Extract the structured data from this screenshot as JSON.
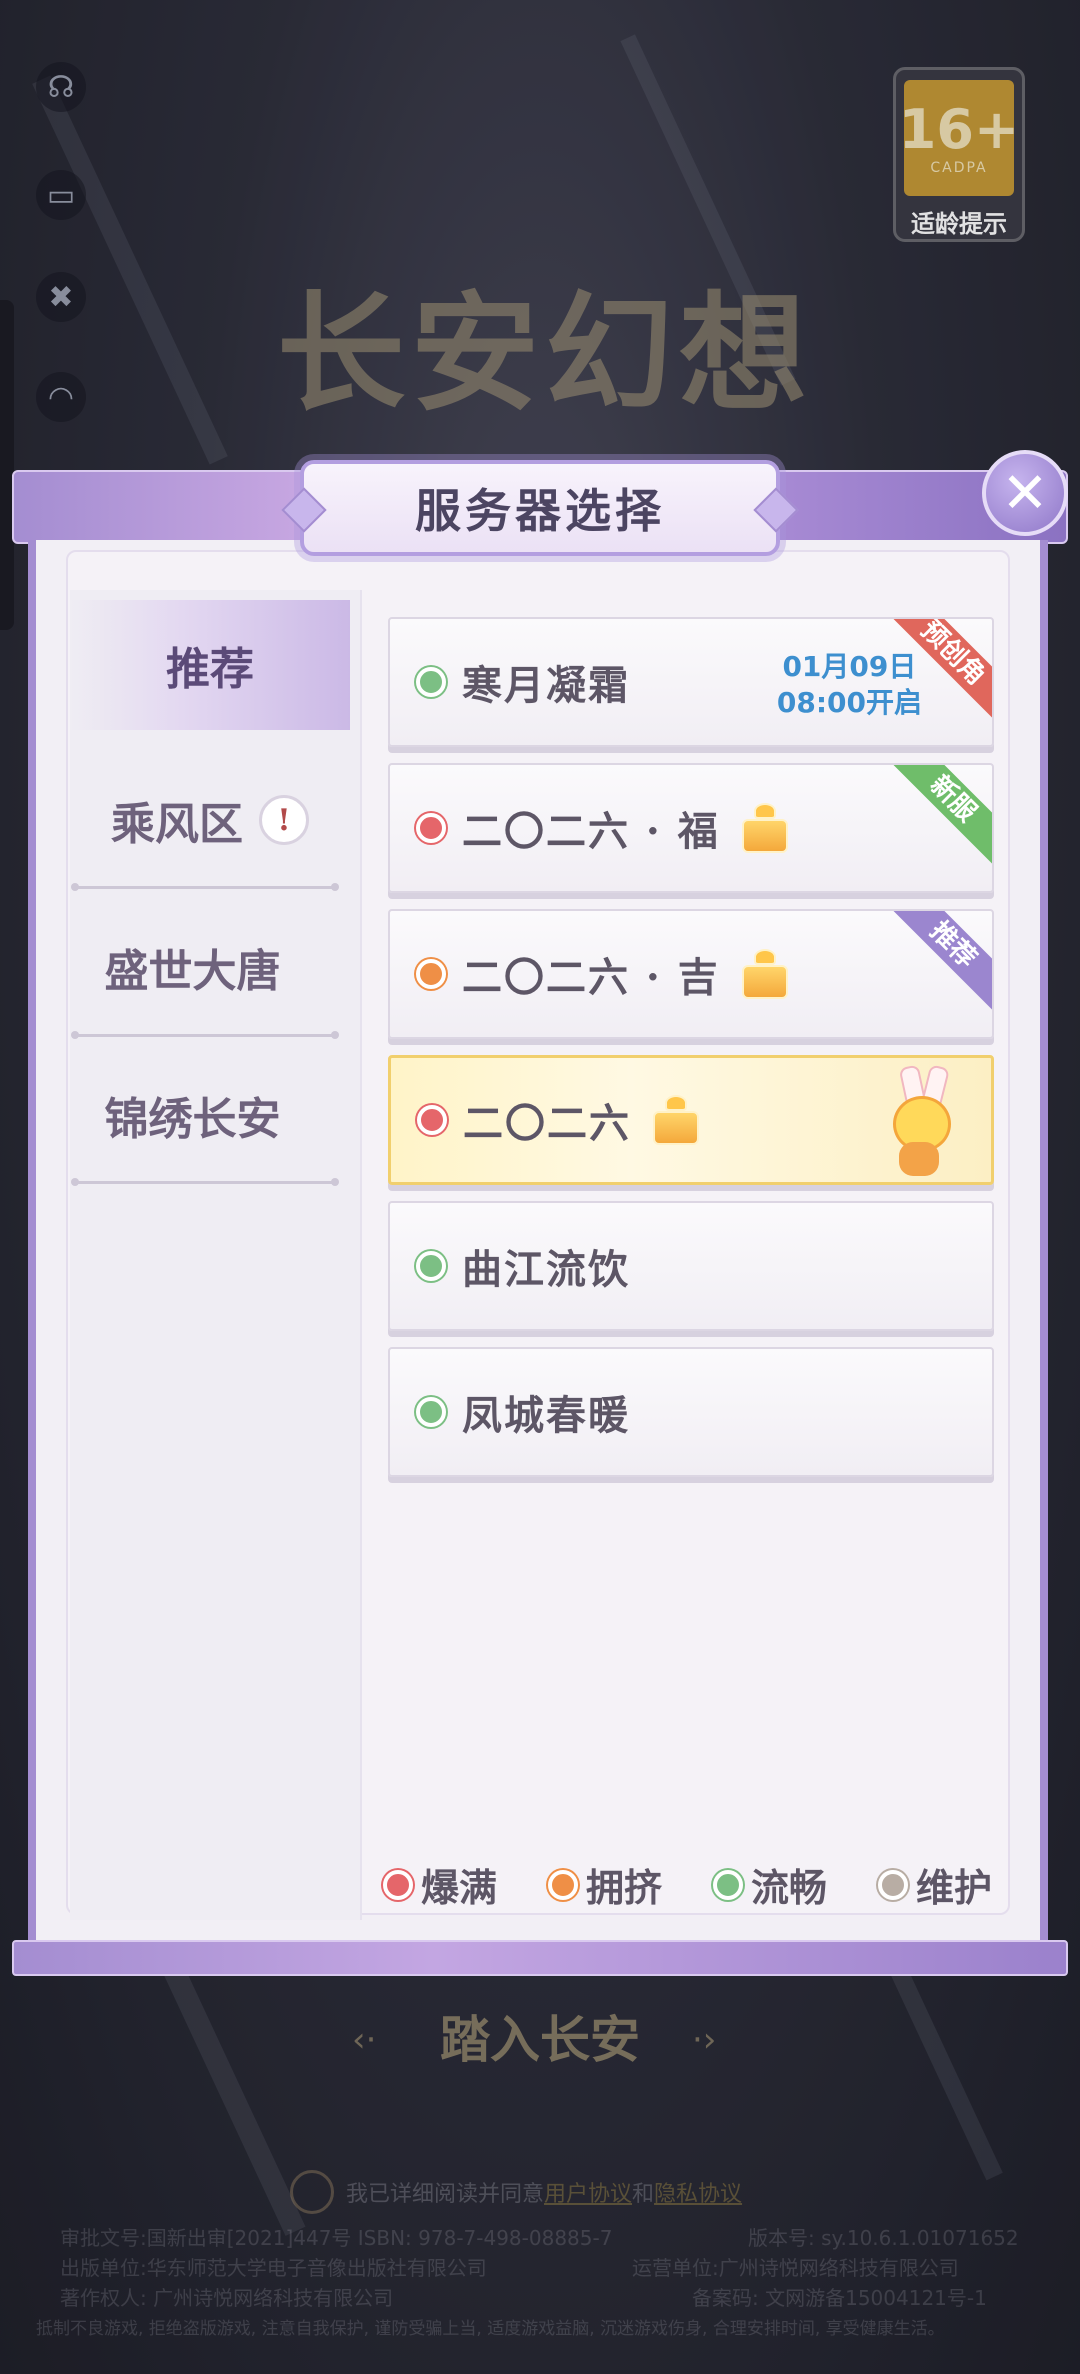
{
  "game": {
    "logo_text": "长安幻想"
  },
  "age_badge": {
    "number": "16+",
    "org": "CADPA",
    "label": "适龄提示"
  },
  "dialog": {
    "title": "服务器选择",
    "close_icon": "close-icon",
    "tabs": [
      {
        "label": "推荐",
        "active": true
      },
      {
        "label": "乘风区",
        "has_alert": true,
        "alert_symbol": "!"
      },
      {
        "label": "盛世大唐"
      },
      {
        "label": "锦绣长安"
      }
    ],
    "servers": [
      {
        "name": "寒月凝霜",
        "status": "流畅",
        "status_color": "#7cbf84",
        "open_date": "01月09日",
        "open_time": "08:00开启",
        "tag": "预创角",
        "tag_color": "#e0675c"
      },
      {
        "name": "二〇二六 · 福",
        "status": "爆满",
        "status_color": "#e5666a",
        "gift": true,
        "tag": "新服",
        "tag_color": "#6fbd6a"
      },
      {
        "name": "二〇二六 · 吉",
        "status": "拥挤",
        "status_color": "#ef8f46",
        "gift": true,
        "tag": "推荐",
        "tag_color": "#9b86cf"
      },
      {
        "name": "二〇二六",
        "status": "爆满",
        "status_color": "#e5666a",
        "gift": true,
        "highlighted": true
      },
      {
        "name": "曲江流饮",
        "status": "流畅",
        "status_color": "#7cbf84"
      },
      {
        "name": "凤城春暖",
        "status": "流畅",
        "status_color": "#7cbf84"
      }
    ],
    "legend": [
      {
        "label": "爆满",
        "color": "#e5666a"
      },
      {
        "label": "拥挤",
        "color": "#ef8f46"
      },
      {
        "label": "流畅",
        "color": "#7cbf84"
      },
      {
        "label": "维护",
        "color": "#b8ada4"
      }
    ]
  },
  "background": {
    "enter_button": "踏入长安",
    "agreement_prefix": "我已详细阅读并同意",
    "user_agreement": "用户协议",
    "and": "和",
    "privacy_agreement": "隐私协议",
    "legal_line1_left": "审批文号:国新出审[2021]447号  ISBN: 978-7-498-08885-7",
    "legal_line1_right": "版本号: sy.10.6.1.01071652",
    "legal_line2_left": "出版单位:华东师范大学电子音像出版社有限公司",
    "legal_line2_right": "运营单位:广州诗悦网络科技有限公司",
    "legal_line3_left": "著作权人: 广州诗悦网络科技有限公司",
    "legal_line3_right": "备案码: 文网游备15004121号-1",
    "legal_line4": "抵制不良游戏, 拒绝盗版游戏, 注意自我保护, 谨防受骗上当, 适度游戏益脑, 沉迷游戏伤身, 合理安排时间, 享受健康生活。"
  }
}
